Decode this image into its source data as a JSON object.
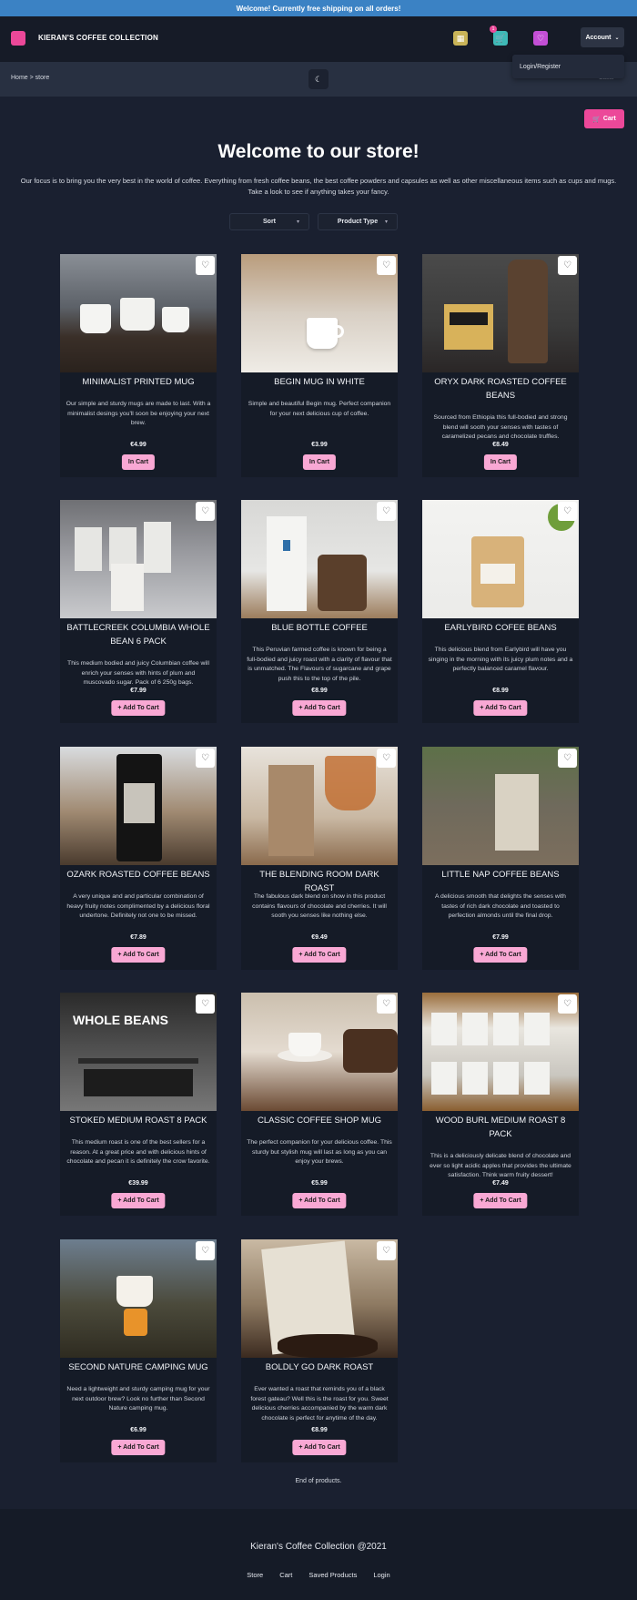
{
  "banner": {
    "text": "Welcome! Currently free shipping on all orders!"
  },
  "nav": {
    "brand": "KIERAN'S COFFEE COLLECTION",
    "cart_badge": "1",
    "account_label": "Account",
    "dropdown_item": "Login/Register"
  },
  "subnav": {
    "breadcrumb": "Home > store",
    "guest": "Guest"
  },
  "cart_button": "Cart",
  "header": {
    "title": "Welcome to our store!",
    "intro": "Our focus is to bring you the very best in the world of coffee. Everything from fresh coffee beans, the best coffee powders and capsules as well as other miscellaneous items such as cups and mugs. Take a look to see if anything takes your fancy."
  },
  "filters": {
    "sort": "Sort",
    "type": "Product Type"
  },
  "products": [
    {
      "name": "Minimalist Printed Mug",
      "desc": "Our simple and sturdy mugs are made to last. With a minimalist desings you'll soon be enjoying your next brew.",
      "price": "€4.99",
      "button": "In Cart"
    },
    {
      "name": "Begin Mug in White",
      "desc": "Simple and beautiful Begin mug. Perfect companion for your next delicious cup of coffee.",
      "price": "€3.99",
      "button": "In Cart"
    },
    {
      "name": "Oryx Dark Roasted Coffee Beans",
      "desc": "Sourced from Ethiopia this full-bodied and strong blend will sooth your senses with tastes of caramelized pecans and chocolate truffles.",
      "price": "€8.49",
      "button": "In Cart"
    },
    {
      "name": "Battlecreek Columbia Whole Bean 6 Pack",
      "desc": "This medium bodied and juicy Columbian coffee will enrich your senses with hints of plum and muscovado sugar. Pack of 6 250g bags.",
      "price": "€7.99",
      "button": "+ Add To Cart"
    },
    {
      "name": "Blue Bottle Coffee",
      "desc": "This Peruvian farmed coffee is known for being a full-bodied and juicy roast with a clarity of flavour that is unmatched. The Flavours of sugarcane and grape push this to the top of the pile.",
      "price": "€8.99",
      "button": "+ Add To Cart"
    },
    {
      "name": "Earlybird Cofee Beans",
      "desc": "This delicious blend from Earlybird will have you singing in the morning with its juicy plum notes and a perfectly balanced caramel flavour.",
      "price": "€8.99",
      "button": "+ Add To Cart"
    },
    {
      "name": "Ozark Roasted Coffee Beans",
      "desc": "A very unique and and particular combination of heavy fruity notes complimented by a delicious floral undertone. Definitely not one to be missed.",
      "price": "€7.89",
      "button": "+ Add To Cart"
    },
    {
      "name": "The Blending Room Dark Roast",
      "desc": "The fabulous dark blend on show in this product contains flavours of chocolate and cherries. It will sooth you senses like nothing else.",
      "price": "€9.49",
      "button": "+ Add To Cart"
    },
    {
      "name": "Little Nap Coffee Beans",
      "desc": "A delicious smooth that delights the senses with tastes of rich dark chocolate and toasted to perfection almonds until the final drop.",
      "price": "€7.99",
      "button": "+ Add To Cart"
    },
    {
      "name": "Stoked Medium Roast 8 Pack",
      "desc": "This medium roast is one of the best sellers for a reason. At a great price and with delicious hints of chocolate and pecan it is definitely the crow favorite.",
      "price": "€39.99",
      "button": "+ Add To Cart"
    },
    {
      "name": "Classic Coffee Shop Mug",
      "desc": "The perfect companion for your delicious coffee. This sturdy but stylish mug will last as long as you can enjoy your brews.",
      "price": "€5.99",
      "button": "+ Add To Cart"
    },
    {
      "name": "Wood Burl Medium Roast 8 Pack",
      "desc": "This is a deliciously delicate blend of chocolate and ever so light acidic apples that provides the ultimate satisfaction. Think warm fruity dessert!",
      "price": "€7.49",
      "button": "+ Add To Cart"
    },
    {
      "name": "Second Nature Camping Mug",
      "desc": "Need a lightweight and sturdy camping mug for your next outdoor brew? Look no further than Second Nature camping mug.",
      "price": "€6.99",
      "button": "+ Add To Cart"
    },
    {
      "name": "Boldly Go Dark Roast",
      "desc": "Ever wanted a roast that reminds you of a black forest gateau? Well this is the roast for you. Sweet delicious cherries accompanied by the warm dark chocolate is perfect for anytime of the day.",
      "price": "€8.99",
      "button": "+ Add To Cart"
    }
  ],
  "end_text": "End of products.",
  "footer": {
    "copyright": "Kieran's Coffee Collection @2021",
    "links": [
      "Store",
      "Cart",
      "Saved Products",
      "Login"
    ]
  },
  "colors": {
    "accent": "#ec4899",
    "button_pink": "#f9a8d4",
    "background": "#1a2030",
    "banner": "#3b82c4"
  }
}
